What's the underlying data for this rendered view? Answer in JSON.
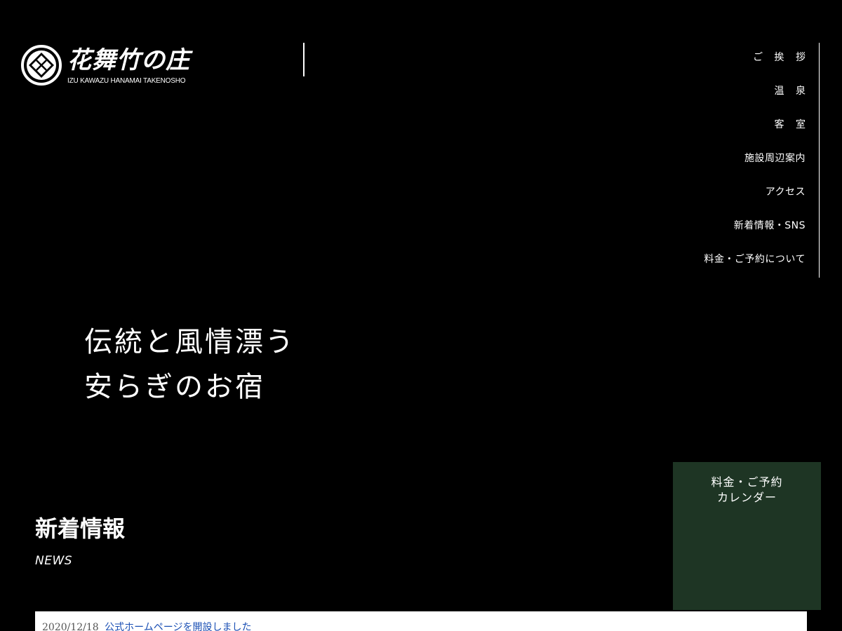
{
  "header": {
    "logo_title": "花舞竹の庄",
    "logo_subtitle": "IZU KAWAZU HANAMAI TAKENOSHO"
  },
  "nav": {
    "items": [
      {
        "label": "ご 挨 拶"
      },
      {
        "label": "温 泉"
      },
      {
        "label": "客 室"
      },
      {
        "label": "施設周辺案内"
      },
      {
        "label": "アクセス"
      },
      {
        "label": "新着情報・SNS"
      },
      {
        "label": "料金・ご予約について"
      }
    ]
  },
  "hero": {
    "line1": "伝統と風情漂う",
    "line2": "安らぎのお宿"
  },
  "booking": {
    "line1": "料金・ご予約",
    "line2": "カレンダー"
  },
  "news": {
    "title": "新着情報",
    "subtitle": "NEWS",
    "entries": [
      {
        "date": "2020/12/18",
        "text": "公式ホームページを開設しました"
      }
    ]
  },
  "colors": {
    "background": "#000000",
    "booking_bg": "#1e3524",
    "link": "#1a4fb4"
  }
}
